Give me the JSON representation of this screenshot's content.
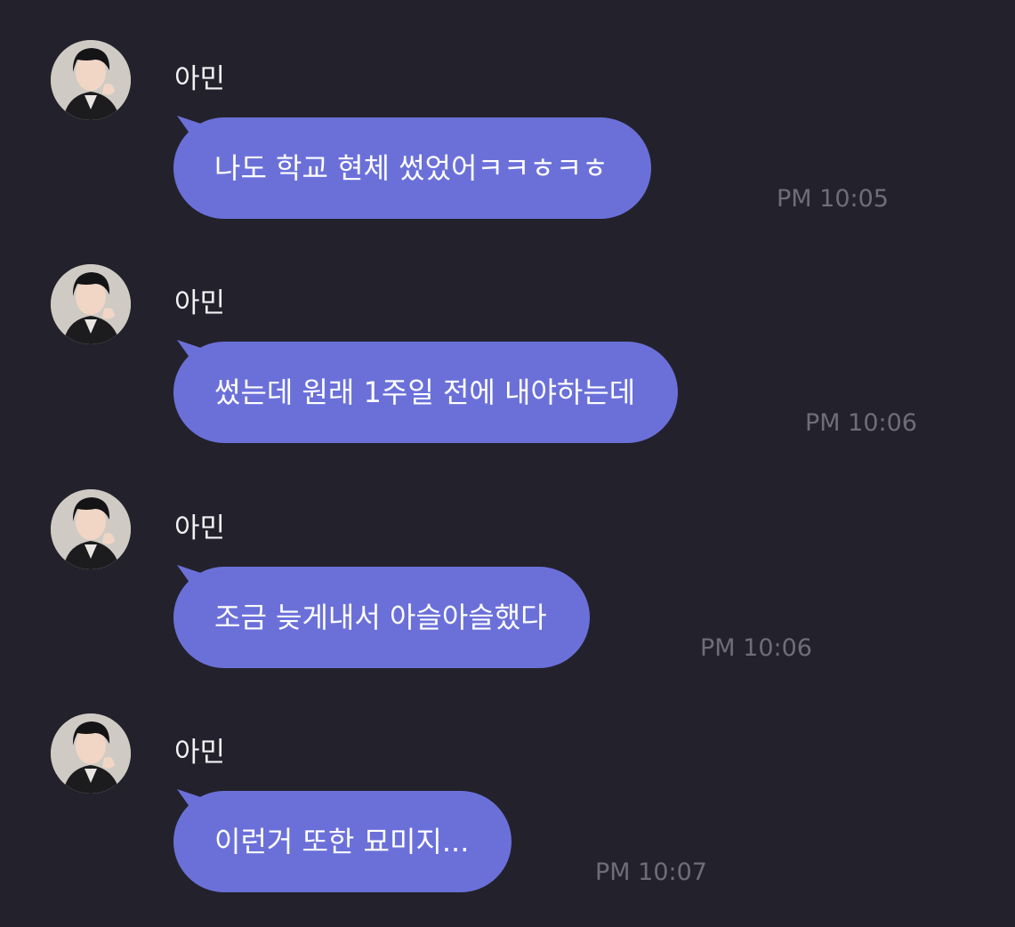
{
  "messages": [
    {
      "sender": "아민",
      "avatar_icon": "profile-photo-icon",
      "text": "나도 학교 현체 썼었어ㅋㅋㅎㅋㅎ",
      "time": "PM 10:05"
    },
    {
      "sender": "아민",
      "avatar_icon": "profile-photo-icon",
      "text": "썼는데 원래 1주일 전에 내야하는데",
      "time": "PM 10:06"
    },
    {
      "sender": "아민",
      "avatar_icon": "profile-photo-icon",
      "text": "조금 늦게내서 아슬아슬했다",
      "time": "PM 10:06"
    },
    {
      "sender": "아민",
      "avatar_icon": "profile-photo-icon",
      "text": "이런거 또한 묘미지...",
      "time": "PM 10:07"
    }
  ],
  "colors": {
    "background": "#23222c",
    "bubble": "#6b70d9",
    "bubble_text": "#ffffff",
    "sender_name": "#f2f2f4",
    "timestamp": "#6e6d78"
  }
}
